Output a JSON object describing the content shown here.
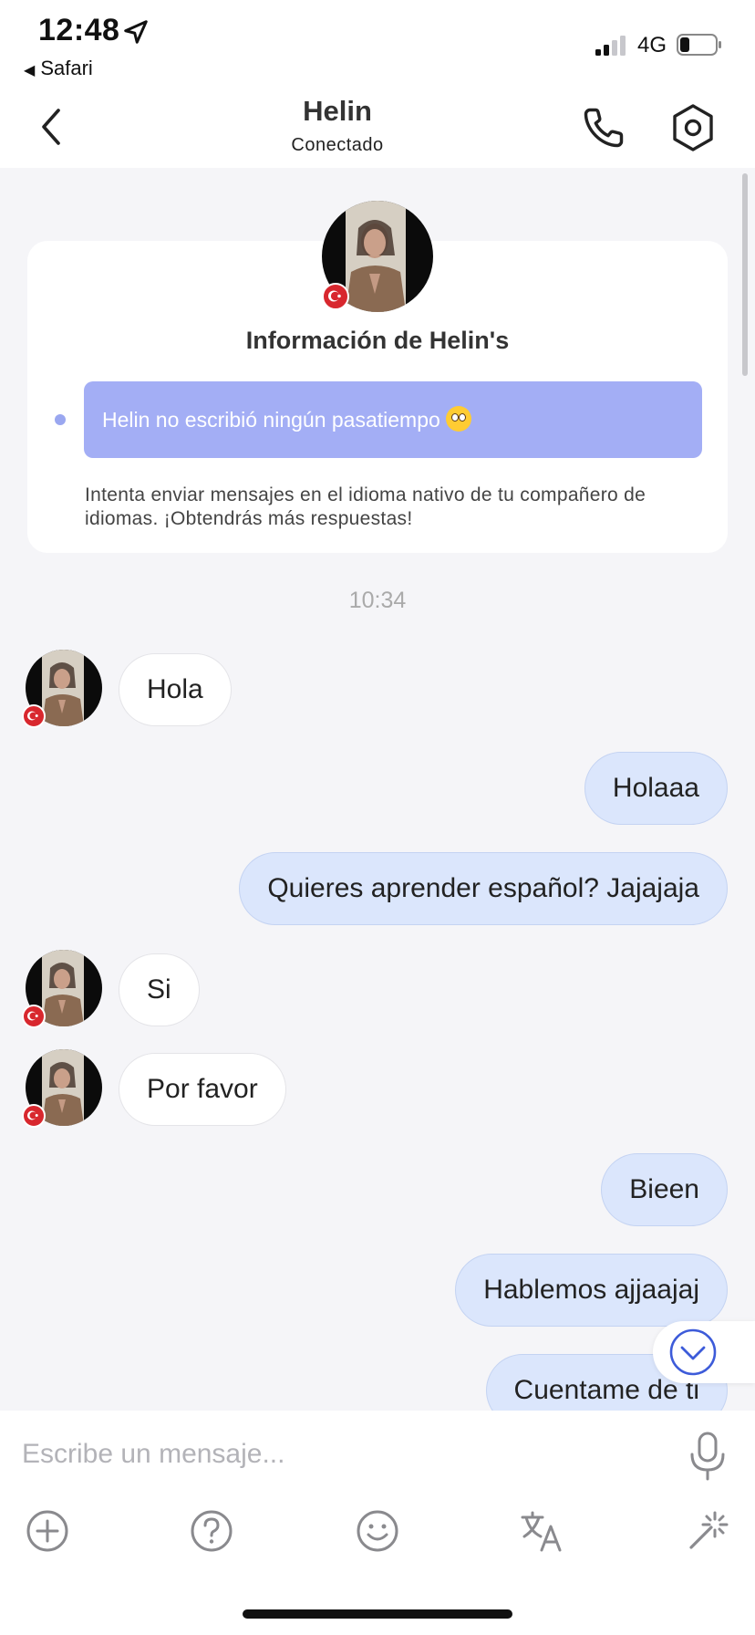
{
  "status_bar": {
    "time": "12:48",
    "back_app": "Safari",
    "network": "4G"
  },
  "header": {
    "name": "Helin",
    "status": "Conectado"
  },
  "info_card": {
    "title": "Información de Helin's",
    "hobby_text": "Helin no escribió ningún pasatiempo",
    "hobby_emoji": "flushed-face-emoji",
    "hint": "Intenta enviar mensajes en el idioma nativo de tu compañero de idiomas. ¡Obtendrás más respuestas!"
  },
  "timestamp": "10:34",
  "messages": [
    {
      "side": "in",
      "text": "Hola"
    },
    {
      "side": "out",
      "text": "Holaaa"
    },
    {
      "side": "out",
      "text": "Quieres aprender español? Jajajaja"
    },
    {
      "side": "in",
      "text": "Si"
    },
    {
      "side": "in",
      "text": "Por favor"
    },
    {
      "side": "out",
      "text": "Bieen"
    },
    {
      "side": "out",
      "text": "Hablemos ajjaajaj"
    },
    {
      "side": "out",
      "text": "Cuentame de ti"
    }
  ],
  "composer": {
    "placeholder": "Escribe un mensaje..."
  },
  "icons": {
    "back": "chevron-left-icon",
    "call": "phone-icon",
    "settings": "hexagon-gear-icon",
    "scroll_down": "chevron-down-circle-icon",
    "mic": "microphone-icon",
    "tools": [
      "plus-circle-icon",
      "question-circle-icon",
      "smiley-icon",
      "translate-icon",
      "magic-wand-icon"
    ]
  },
  "colors": {
    "accent": "#3d5bd9",
    "hobby_bg": "#a3aef5",
    "outgoing_bubble": "#dbe6fc",
    "flag_red": "#d8272e"
  }
}
